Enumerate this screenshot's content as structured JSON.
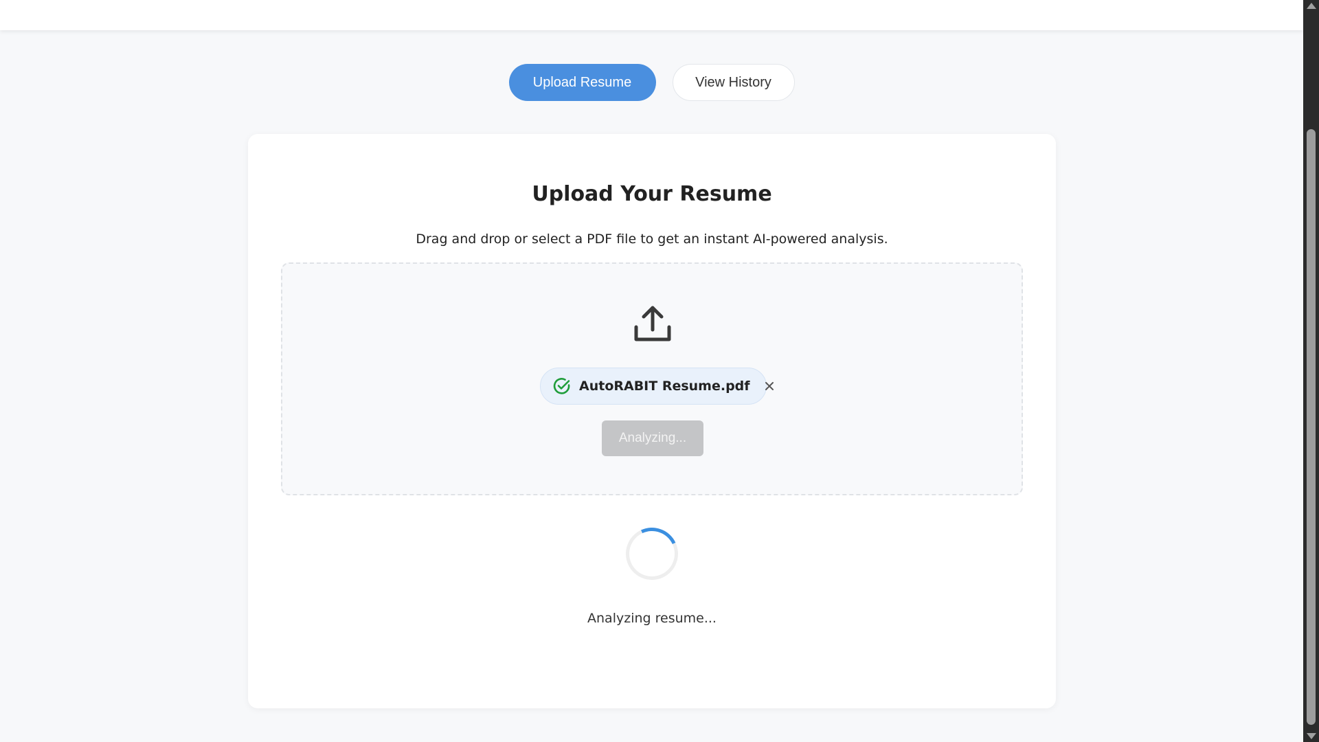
{
  "tabs": [
    {
      "label": "Upload Resume",
      "active": true
    },
    {
      "label": "View History",
      "active": false
    }
  ],
  "card": {
    "title": "Upload Your Resume",
    "subtitle": "Drag and drop or select a PDF file to get an instant AI-powered analysis."
  },
  "dropzone": {
    "icon": "upload-icon",
    "file": {
      "name": "AutoRABIT Resume.pdf",
      "status_icon": "check-circle-icon",
      "remove_icon": "close-icon"
    },
    "button_label": "Analyzing..."
  },
  "status": {
    "text": "Analyzing resume..."
  },
  "colors": {
    "accent": "#4a8fdf",
    "success": "#1f9d3a",
    "spinner": "#3b8fe0",
    "disabled": "#c4c5c7"
  }
}
